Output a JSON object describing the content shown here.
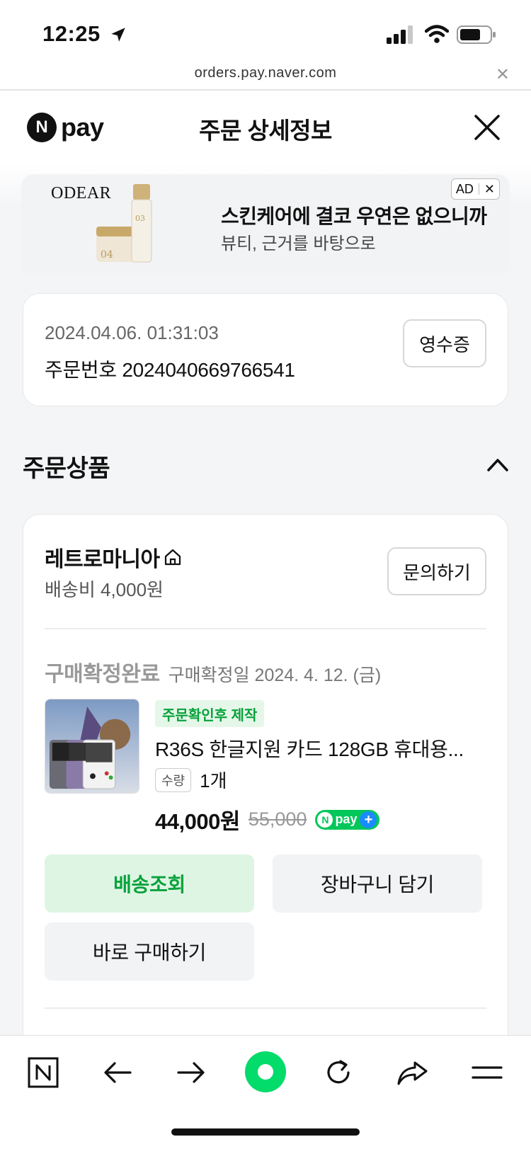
{
  "status_bar": {
    "time": "12:25",
    "icons": [
      "location-arrow-icon",
      "cellular-signal-icon",
      "wifi-icon",
      "battery-icon"
    ]
  },
  "url_bar": {
    "url": "orders.pay.naver.com",
    "close": "✕"
  },
  "header": {
    "logo_n": "N",
    "logo_word": "pay",
    "title": "주문 상세정보"
  },
  "ad": {
    "brand": "ODEAR",
    "headline": "스킨케어에 결코 우연은 없으니까",
    "subtext": "뷰티, 근거를 바탕으로",
    "badge": "AD",
    "badge_close": "✕"
  },
  "order": {
    "datetime": "2024.04.06. 01:31:03",
    "number_text": "주문번호 2024040669766541",
    "receipt_label": "영수증"
  },
  "section": {
    "title": "주문상품"
  },
  "store": {
    "name": "레트로마니아",
    "shipping_fee": "배송비 4,000원",
    "inquiry_label": "문의하기"
  },
  "item": {
    "status": "구매확정완료",
    "confirm_date": "구매확정일 2024. 4. 12. (금)",
    "tag": "주문확인후 제작",
    "name": "R36S 한글지원 카드 128GB 휴대용...",
    "qty_label": "수량",
    "qty_value": "1개",
    "price": "44,000원",
    "original_price": "55,000",
    "npay_n": "N",
    "npay_word": "pay",
    "npay_plus": "+"
  },
  "actions": {
    "track": "배송조회",
    "cart": "장바구니 담기",
    "buy": "바로 구매하기"
  },
  "toolbar": {
    "icons": [
      "naver-home-icon",
      "back-arrow-icon",
      "forward-arrow-icon",
      "green-dot-icon",
      "reload-icon",
      "share-icon",
      "menu-icon"
    ],
    "home_letter": "N"
  },
  "colors": {
    "accent_green": "#03c75a",
    "track_bg": "#dff5e4",
    "track_text": "#08a23c"
  }
}
